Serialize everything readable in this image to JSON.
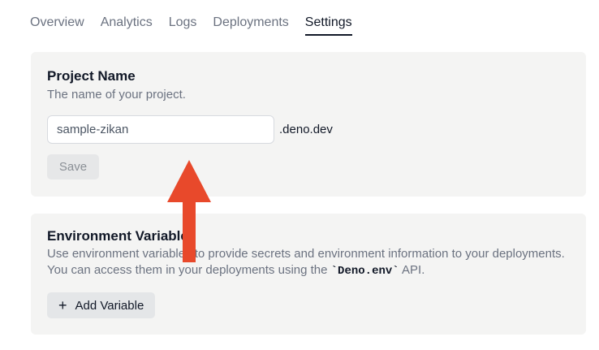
{
  "tabs": [
    {
      "label": "Overview",
      "active": false
    },
    {
      "label": "Analytics",
      "active": false
    },
    {
      "label": "Logs",
      "active": false
    },
    {
      "label": "Deployments",
      "active": false
    },
    {
      "label": "Settings",
      "active": true
    }
  ],
  "project": {
    "title": "Project Name",
    "description": "The name of your project.",
    "input_value": "sample-zikan",
    "suffix": ".deno.dev",
    "save_label": "Save"
  },
  "env": {
    "title": "Environment Variables",
    "description_part1": "Use environment variables to provide secrets and environment information to your deployments. You can access them in your deployments using the ",
    "code": "`Deno.env`",
    "description_part2": " API.",
    "add_label": "Add Variable",
    "add_icon": "plus-icon"
  },
  "annotation": {
    "arrow_color": "#e8492b",
    "arrow_icon": "up-arrow-icon"
  }
}
